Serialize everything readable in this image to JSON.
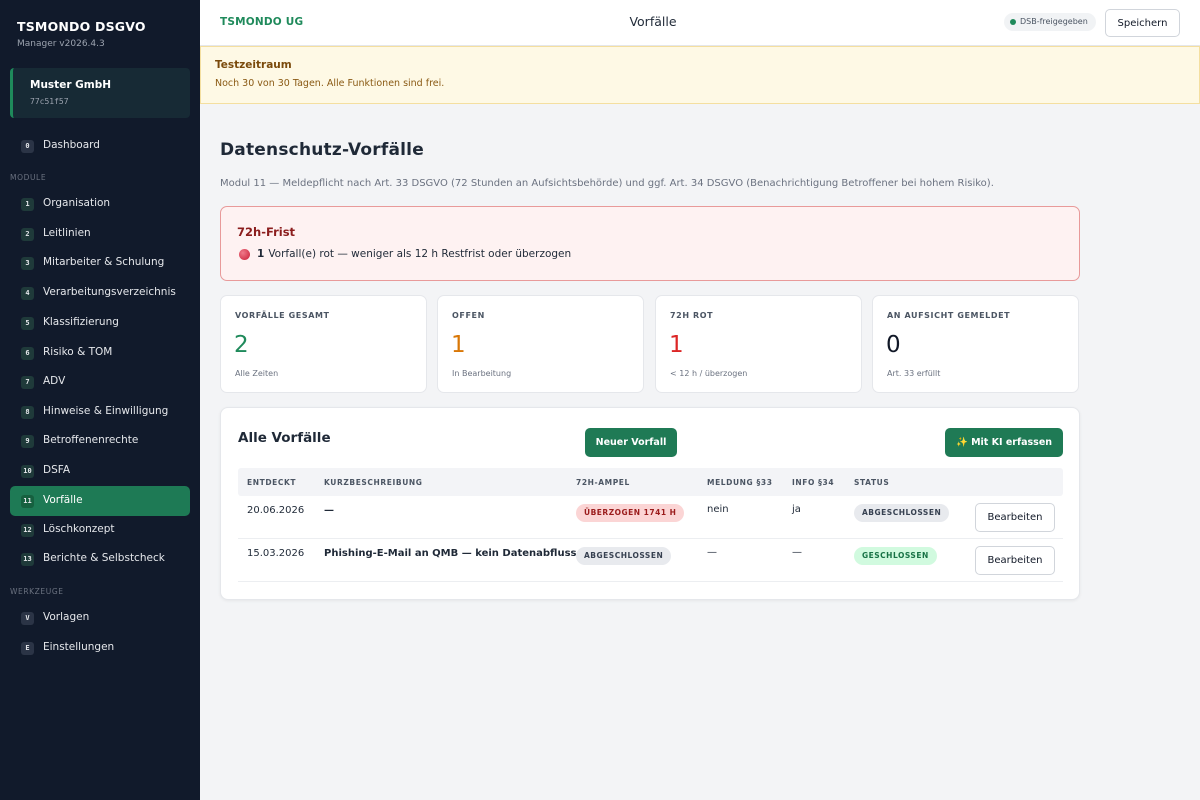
{
  "sidebar": {
    "brand": "TSMONDO DSGVO",
    "version": "Manager v2026.4.3",
    "tenant": {
      "name": "Muster GmbH",
      "id": "77c51f57"
    },
    "dashboard": {
      "badge": "0",
      "label": "Dashboard"
    },
    "modules_label": "MODULE",
    "modules": [
      {
        "badge": "1",
        "label": "Organisation"
      },
      {
        "badge": "2",
        "label": "Leitlinien"
      },
      {
        "badge": "3",
        "label": "Mitarbeiter & Schulung"
      },
      {
        "badge": "4",
        "label": "Verarbeitungsverzeichnis"
      },
      {
        "badge": "5",
        "label": "Klassifizierung"
      },
      {
        "badge": "6",
        "label": "Risiko & TOM"
      },
      {
        "badge": "7",
        "label": "ADV"
      },
      {
        "badge": "8",
        "label": "Hinweise & Einwilligung"
      },
      {
        "badge": "9",
        "label": "Betroffenenrechte"
      },
      {
        "badge": "10",
        "label": "DSFA"
      },
      {
        "badge": "11",
        "label": "Vorfälle"
      },
      {
        "badge": "12",
        "label": "Löschkonzept"
      },
      {
        "badge": "13",
        "label": "Berichte & Selbstcheck"
      }
    ],
    "active_module": "Vorfälle",
    "tools_label": "WERKZEUGE",
    "tools": [
      {
        "badge": "V",
        "label": "Vorlagen"
      },
      {
        "badge": "E",
        "label": "Einstellungen"
      }
    ]
  },
  "topbar": {
    "org": "TSMONDO UG",
    "title": "Vorfälle",
    "dsb_status": "DSB-freigegeben",
    "save_label": "Speichern"
  },
  "trial": {
    "title": "Testzeitraum",
    "text": "Noch 30 von 30 Tagen. Alle Funktionen sind frei."
  },
  "page": {
    "title": "Datenschutz-Vorfälle",
    "subtitle": "Modul 11 — Meldepflicht nach Art. 33 DSGVO (72 Stunden an Aufsichtsbehörde) und ggf. Art. 34 DSGVO (Benachrichtigung Betroffener bei hohem Risiko)."
  },
  "alert": {
    "title": "72h-Frist",
    "count": "1",
    "text": "Vorfall(e) rot — weniger als 12 h Restfrist oder überzogen"
  },
  "kpis": [
    {
      "label": "VORFÄLLE GESAMT",
      "value": "2",
      "sub": "Alle Zeiten",
      "color": "#1f8a5b"
    },
    {
      "label": "OFFEN",
      "value": "1",
      "sub": "In Bearbeitung",
      "color": "#d97706"
    },
    {
      "label": "72H ROT",
      "value": "1",
      "sub": "< 12 h / überzogen",
      "color": "#dc2626"
    },
    {
      "label": "AN AUFSICHT GEMELDET",
      "value": "0",
      "sub": "Art. 33 erfüllt",
      "color": "#111827"
    }
  ],
  "incidents": {
    "title": "Alle Vorfälle",
    "new_label": "Neuer Vorfall",
    "ai_label": "✨ Mit KI erfassen",
    "columns": [
      "ENTDECKT",
      "KURZBESCHREIBUNG",
      "72H-AMPEL",
      "MELDUNG §33",
      "INFO §34",
      "STATUS"
    ],
    "rows": [
      {
        "date": "20.06.2026",
        "desc": "—",
        "ampel": "ÜBERZOGEN 1741 H",
        "meldung": "nein",
        "info": "ja",
        "status": "ABGESCHLOSSEN",
        "action": "Bearbeiten"
      },
      {
        "date": "15.03.2026",
        "desc": "Phishing-E-Mail an QMB — kein Datenabfluss",
        "ampel": "ABGESCHLOSSEN",
        "meldung": "—",
        "info": "—",
        "status": "GESCHLOSSEN",
        "action": "Bearbeiten"
      }
    ]
  },
  "colors": {
    "sidebar_bg": "#111a2b",
    "accent": "#1f7a55",
    "alert_border": "#e89a9a"
  }
}
